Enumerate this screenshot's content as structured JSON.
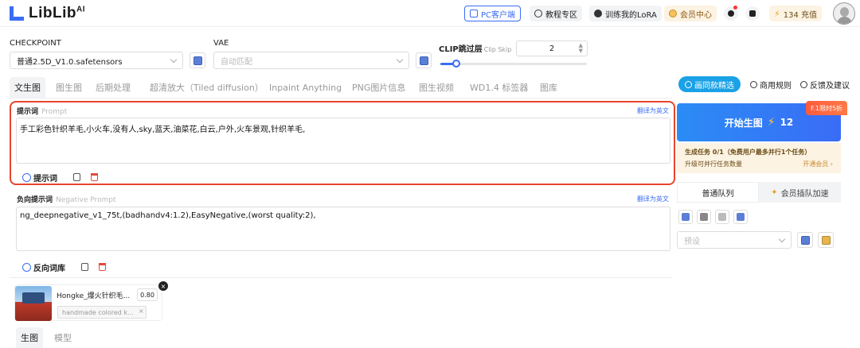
{
  "header": {
    "logo_text": "LibLib",
    "logo_sup": "AI",
    "pc_client": "PC客户端",
    "tutorials": "教程专区",
    "train_lora": "训练我的LoRA",
    "vip_center": "会员中心",
    "credits": "134 充值"
  },
  "models": {
    "checkpoint_label": "CHECKPOINT",
    "checkpoint_value": "普通2.5D_V1.0.safetensors",
    "vae_label": "VAE",
    "vae_placeholder": "自动匹配",
    "clip_label": "CLIP跳过层",
    "clip_sublabel": "Clip Skip",
    "clip_value": "2",
    "clip_slider_fraction": 0.2
  },
  "tabs": [
    {
      "label": "文生图",
      "active": true
    },
    {
      "label": "图生图"
    },
    {
      "label": "后期处理"
    },
    {
      "label": "超清放大（Tiled diffusion）"
    },
    {
      "label": "Inpaint Anything"
    },
    {
      "label": "PNG图片信息"
    },
    {
      "label": "图生视频"
    },
    {
      "label": "WD1.4 标签器"
    },
    {
      "label": "图库"
    }
  ],
  "prompt": {
    "label": "提示词",
    "sublabel": "Prompt",
    "translate": "翻译为英文",
    "text": "手工彩色针织羊毛,小火车,没有人,sky,蓝天,油菜花,白云,户外,火车景观,针织羊毛,",
    "library_button": "提示词"
  },
  "negative": {
    "label": "负向提示词",
    "sublabel": "Negative Prompt",
    "translate": "翻译为英文",
    "text": "ng_deepnegative_v1_75t,(badhandv4:1.2),EasyNegative,(worst quality:2),",
    "library_button": "反向词库"
  },
  "lora": {
    "name": "Hongke_爆火针织毛...",
    "weight": "0.80",
    "trigger": "handmade colored k...",
    "close": "×"
  },
  "bottom_tabs": {
    "gen": "生图",
    "model": "模型"
  },
  "right": {
    "featured": "画同款精选",
    "rules": "商用规则",
    "feedback": "反馈及建议",
    "promo": "F.1限时5折",
    "generate": "开始生图",
    "generate_cost": "12",
    "task_title": "生成任务 0/1（免费用户最多并行1个任务）",
    "task_sub": "升级可并行任务数量",
    "task_link": "开通会员 ›",
    "queue_normal": "普通队列",
    "queue_vip": "会员插队加速",
    "preset_placeholder": "预设"
  },
  "colors": {
    "accent": "#3a6cf6",
    "highlight": "#e8452c",
    "promo": "#ff5a3c"
  }
}
